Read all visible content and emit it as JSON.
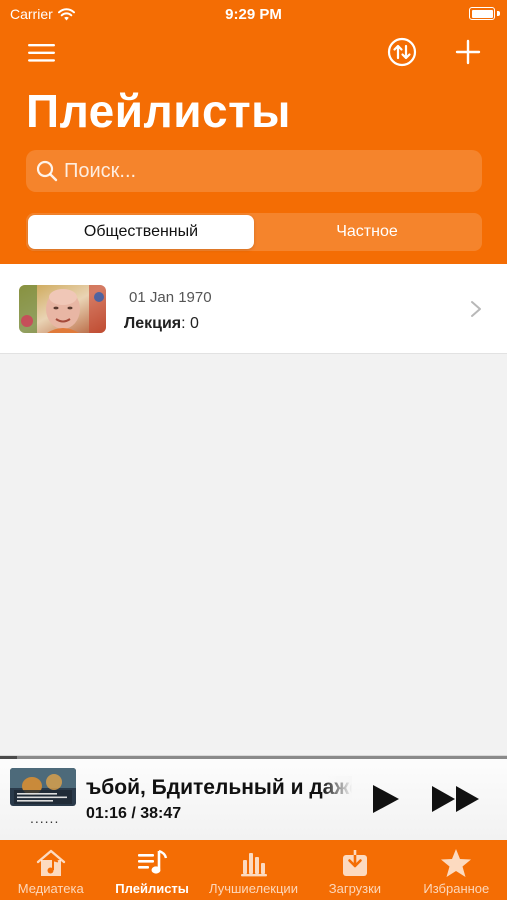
{
  "status_bar": {
    "carrier": "Carrier",
    "time": "9:29 PM"
  },
  "header": {
    "title": "Плейлисты",
    "menu_icon": "hamburger-menu-icon",
    "sort_icon": "sort-arrows-icon",
    "add_icon": "plus-icon"
  },
  "search": {
    "placeholder": "Поиск...",
    "value": ""
  },
  "segments": {
    "public": "Общественный",
    "private": "Частное",
    "selected": "public"
  },
  "playlists": [
    {
      "date": "01 Jan 1970",
      "count_label": "Лекция",
      "count_sep": ": ",
      "count": "0"
    }
  ],
  "player": {
    "title": "ъбой, Бдительный и даже",
    "subtitle": "......",
    "time": "01:16 / 38:47",
    "progress": 0.033,
    "play_icon": "play-icon",
    "forward_icon": "fast-forward-icon"
  },
  "tabs": [
    {
      "label": "Медиатека",
      "icon": "home-music-icon"
    },
    {
      "label": "Плейлисты",
      "icon": "playlist-icon"
    },
    {
      "label": "Лучшиелекции",
      "icon": "bar-chart-icon"
    },
    {
      "label": "Загрузки",
      "icon": "download-icon"
    },
    {
      "label": "Избранное",
      "icon": "star-icon"
    }
  ],
  "active_tab": 1,
  "colors": {
    "accent": "#f46d04",
    "background": "#f2f2f2"
  }
}
